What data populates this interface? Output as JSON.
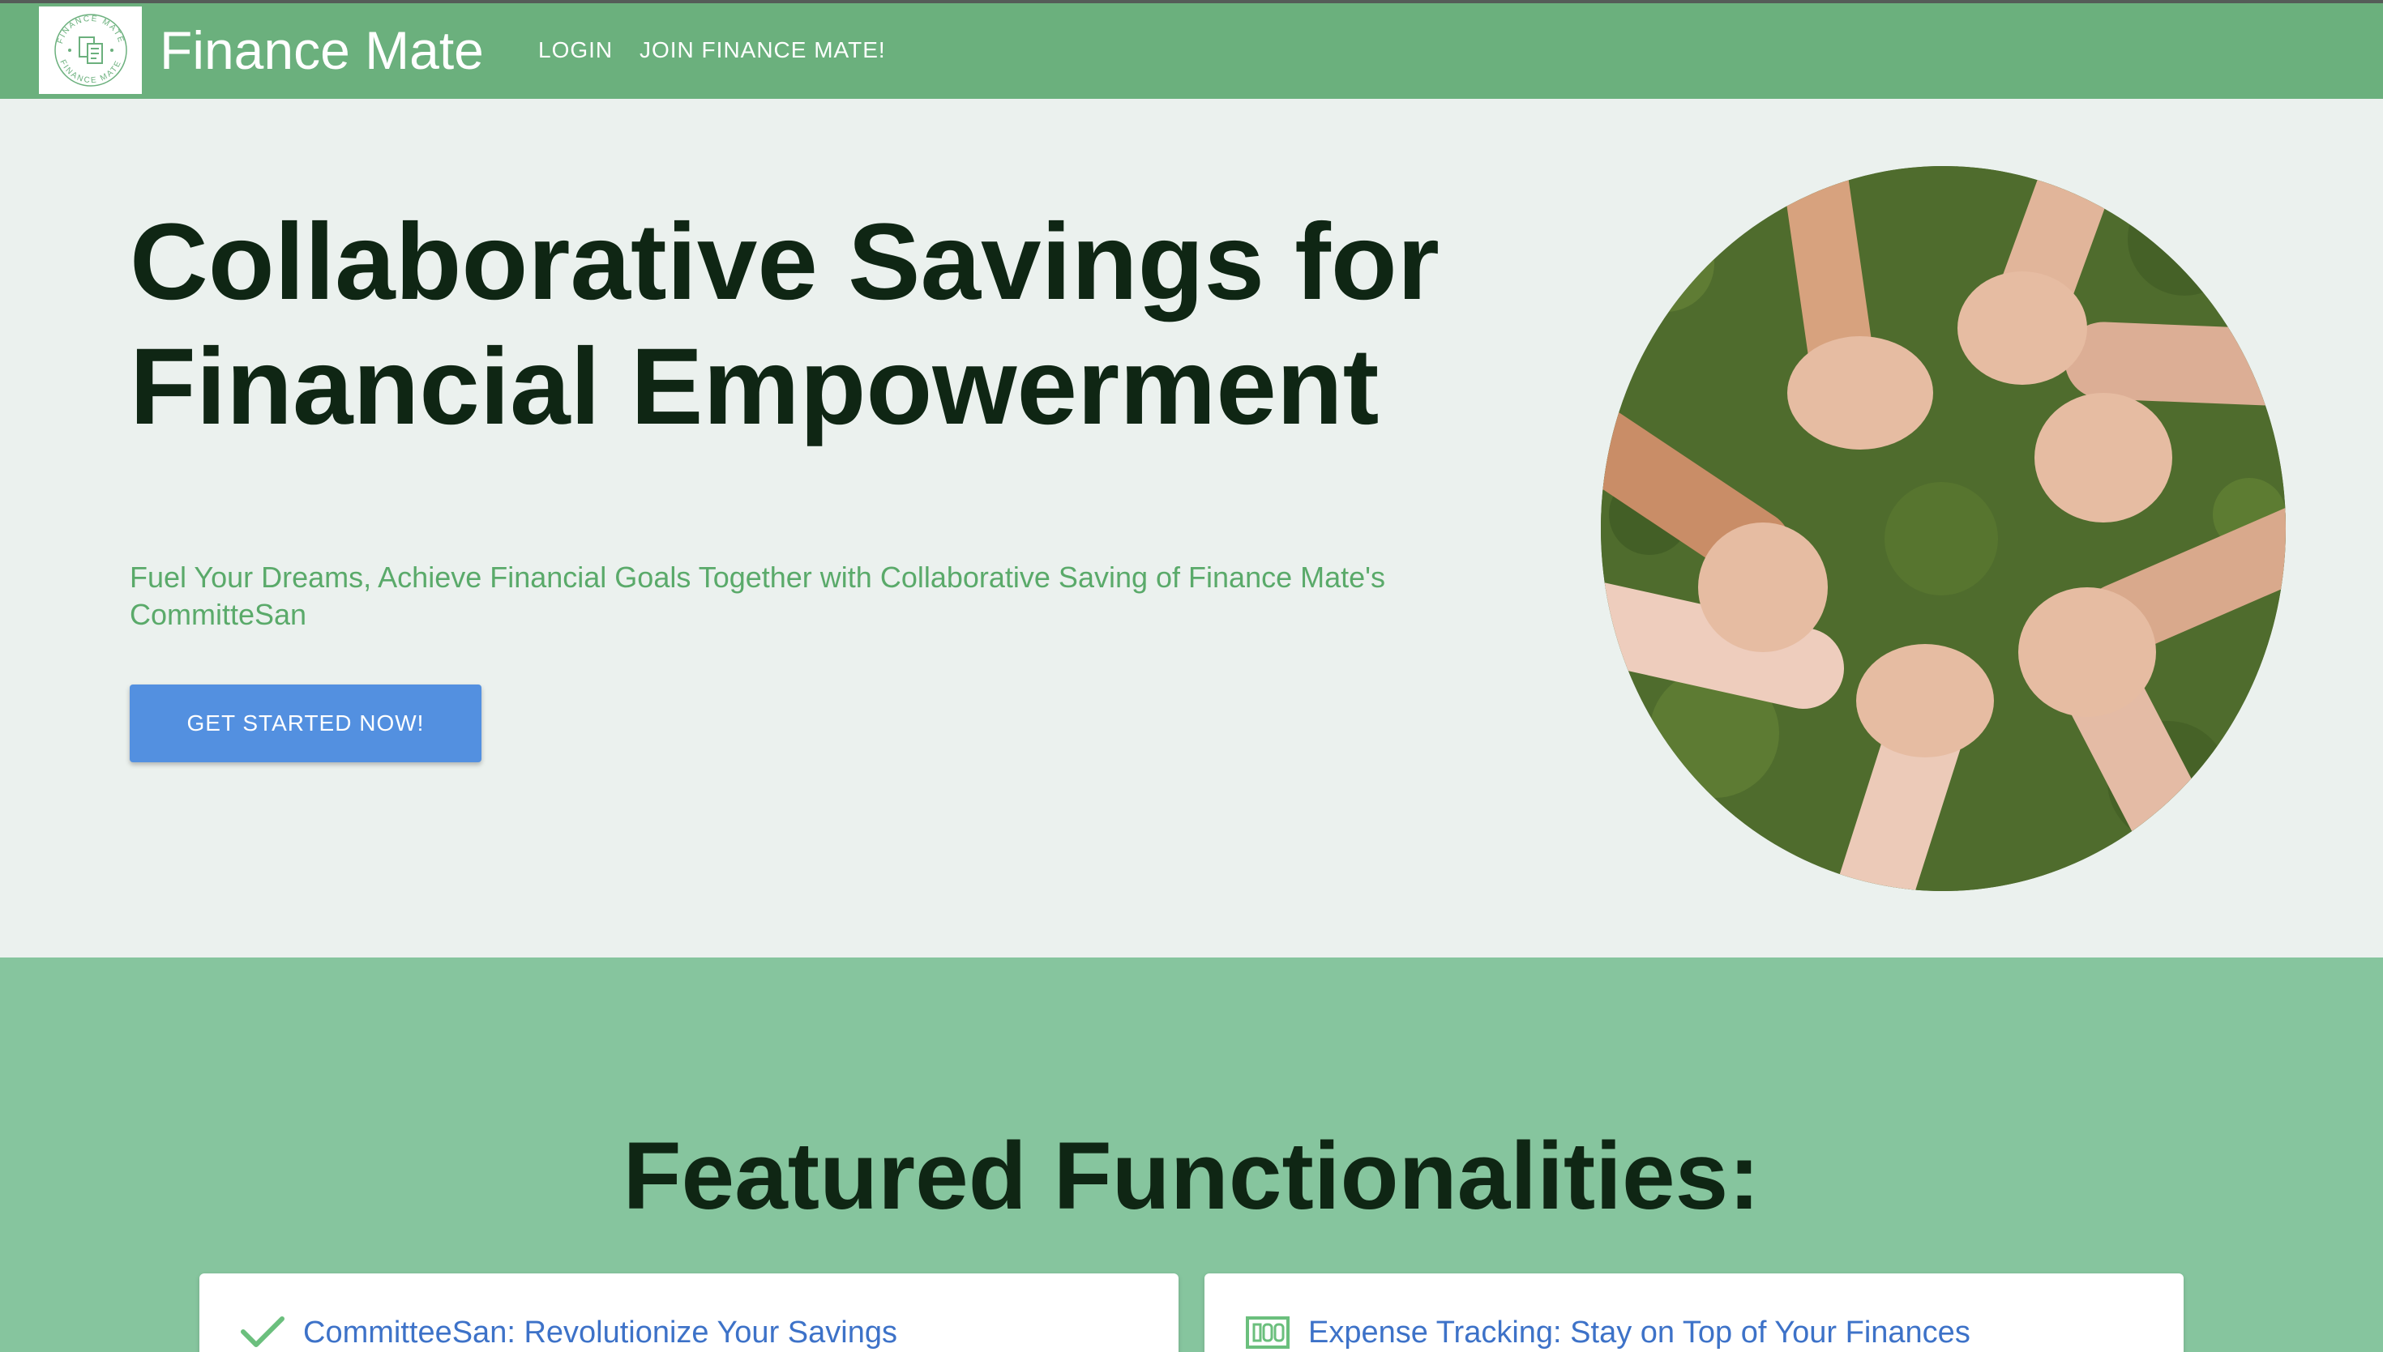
{
  "header": {
    "brand": "Finance Mate",
    "logo": {
      "ring_text": "FINANCE MATE",
      "icon": "finance-mate-logo"
    },
    "nav": [
      {
        "label": "LOGIN"
      },
      {
        "label": "JOIN FINANCE MATE!"
      }
    ]
  },
  "hero": {
    "title": "Collaborative Savings for Financial Empowerment",
    "subtitle": "Fuel Your Dreams, Achieve Financial Goals Together with Collaborative Saving of Finance Mate's CommitteSan",
    "cta_label": "GET STARTED NOW!",
    "image": "circle of joined hands on grass"
  },
  "features": {
    "title": "Featured Functionalities:",
    "cards": [
      {
        "title": "CommitteeSan: Revolutionize Your Savings",
        "icon": "checkmark-icon"
      },
      {
        "title": "Expense Tracking: Stay on Top of Your Finances",
        "icon": "money-bill-icon"
      }
    ]
  },
  "colors": {
    "header_bg": "#6bb07d",
    "hero_bg": "#ebf1ee",
    "features_bg": "#86c59e",
    "accent_blue": "#5390e0",
    "subtitle_green": "#5aaa6a",
    "heading_dark": "#0f2614"
  }
}
